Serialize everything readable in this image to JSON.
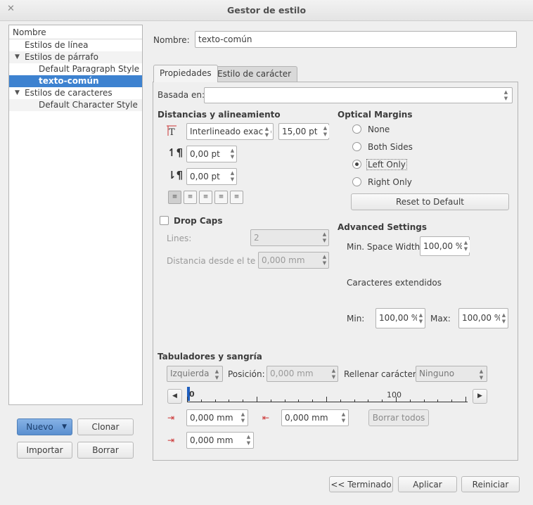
{
  "window": {
    "title": "Gestor de estilo",
    "close_icon": "close-icon"
  },
  "tree": {
    "header": "Nombre",
    "items": [
      {
        "label": "Estilos de línea",
        "level": 1
      },
      {
        "label": "Estilos de párrafo",
        "level": 1,
        "expanded": true
      },
      {
        "label": "Default Paragraph Style",
        "level": 2
      },
      {
        "label": "texto-común",
        "level": 2,
        "selected": true
      },
      {
        "label": "Estilos de caracteres",
        "level": 1,
        "expanded": true
      },
      {
        "label": "Default Character Style",
        "level": 2
      }
    ]
  },
  "left_buttons": {
    "nuevo": "Nuevo",
    "clonar": "Clonar",
    "importar": "Importar",
    "borrar": "Borrar"
  },
  "name": {
    "label": "Nombre:",
    "value": "texto-común"
  },
  "tabs": {
    "propiedades": "Propiedades",
    "estilo_caracter": "Estilo de carácter"
  },
  "based_on": {
    "label": "Basada en:",
    "value": ""
  },
  "distances": {
    "title": "Distancias y alineamiento",
    "line_spacing_mode": "Interlineado exacto",
    "line_spacing": "15,00 pt",
    "space_above": "0,00 pt",
    "space_below": "0,00 pt"
  },
  "drop_caps": {
    "label": "Drop Caps",
    "lines_label": "Lines:",
    "lines_value": "2",
    "distance_label": "Distancia desde el texto",
    "distance_value": "0,000 mm"
  },
  "optical_margins": {
    "title": "Optical Margins",
    "options": [
      "None",
      "Both Sides",
      "Left Only",
      "Right Only"
    ],
    "selected": "Left Only",
    "reset": "Reset to Default"
  },
  "advanced": {
    "title": "Advanced Settings",
    "min_space_label": "Min. Space Width:",
    "min_space_value": "100,00 %",
    "extended_label": "Caracteres extendidos",
    "min_label": "Min:",
    "min_value": "100,00 %",
    "max_label": "Max:",
    "max_value": "100,00 %"
  },
  "tabs_section": {
    "title": "Tabuladores y sangría",
    "align": "Izquierda",
    "position_label": "Posición:",
    "position_value": "0,000 mm",
    "fill_label": "Rellenar carácter:",
    "fill_value": "Ninguno",
    "ruler_start": "0",
    "ruler_mid": "100",
    "first_indent": "0,000 mm",
    "right_indent": "0,000 mm",
    "left_indent": "0,000 mm",
    "clear_all": "Borrar todos"
  },
  "footer": {
    "done": "<< Terminado",
    "apply": "Aplicar",
    "reset": "Reiniciar"
  }
}
